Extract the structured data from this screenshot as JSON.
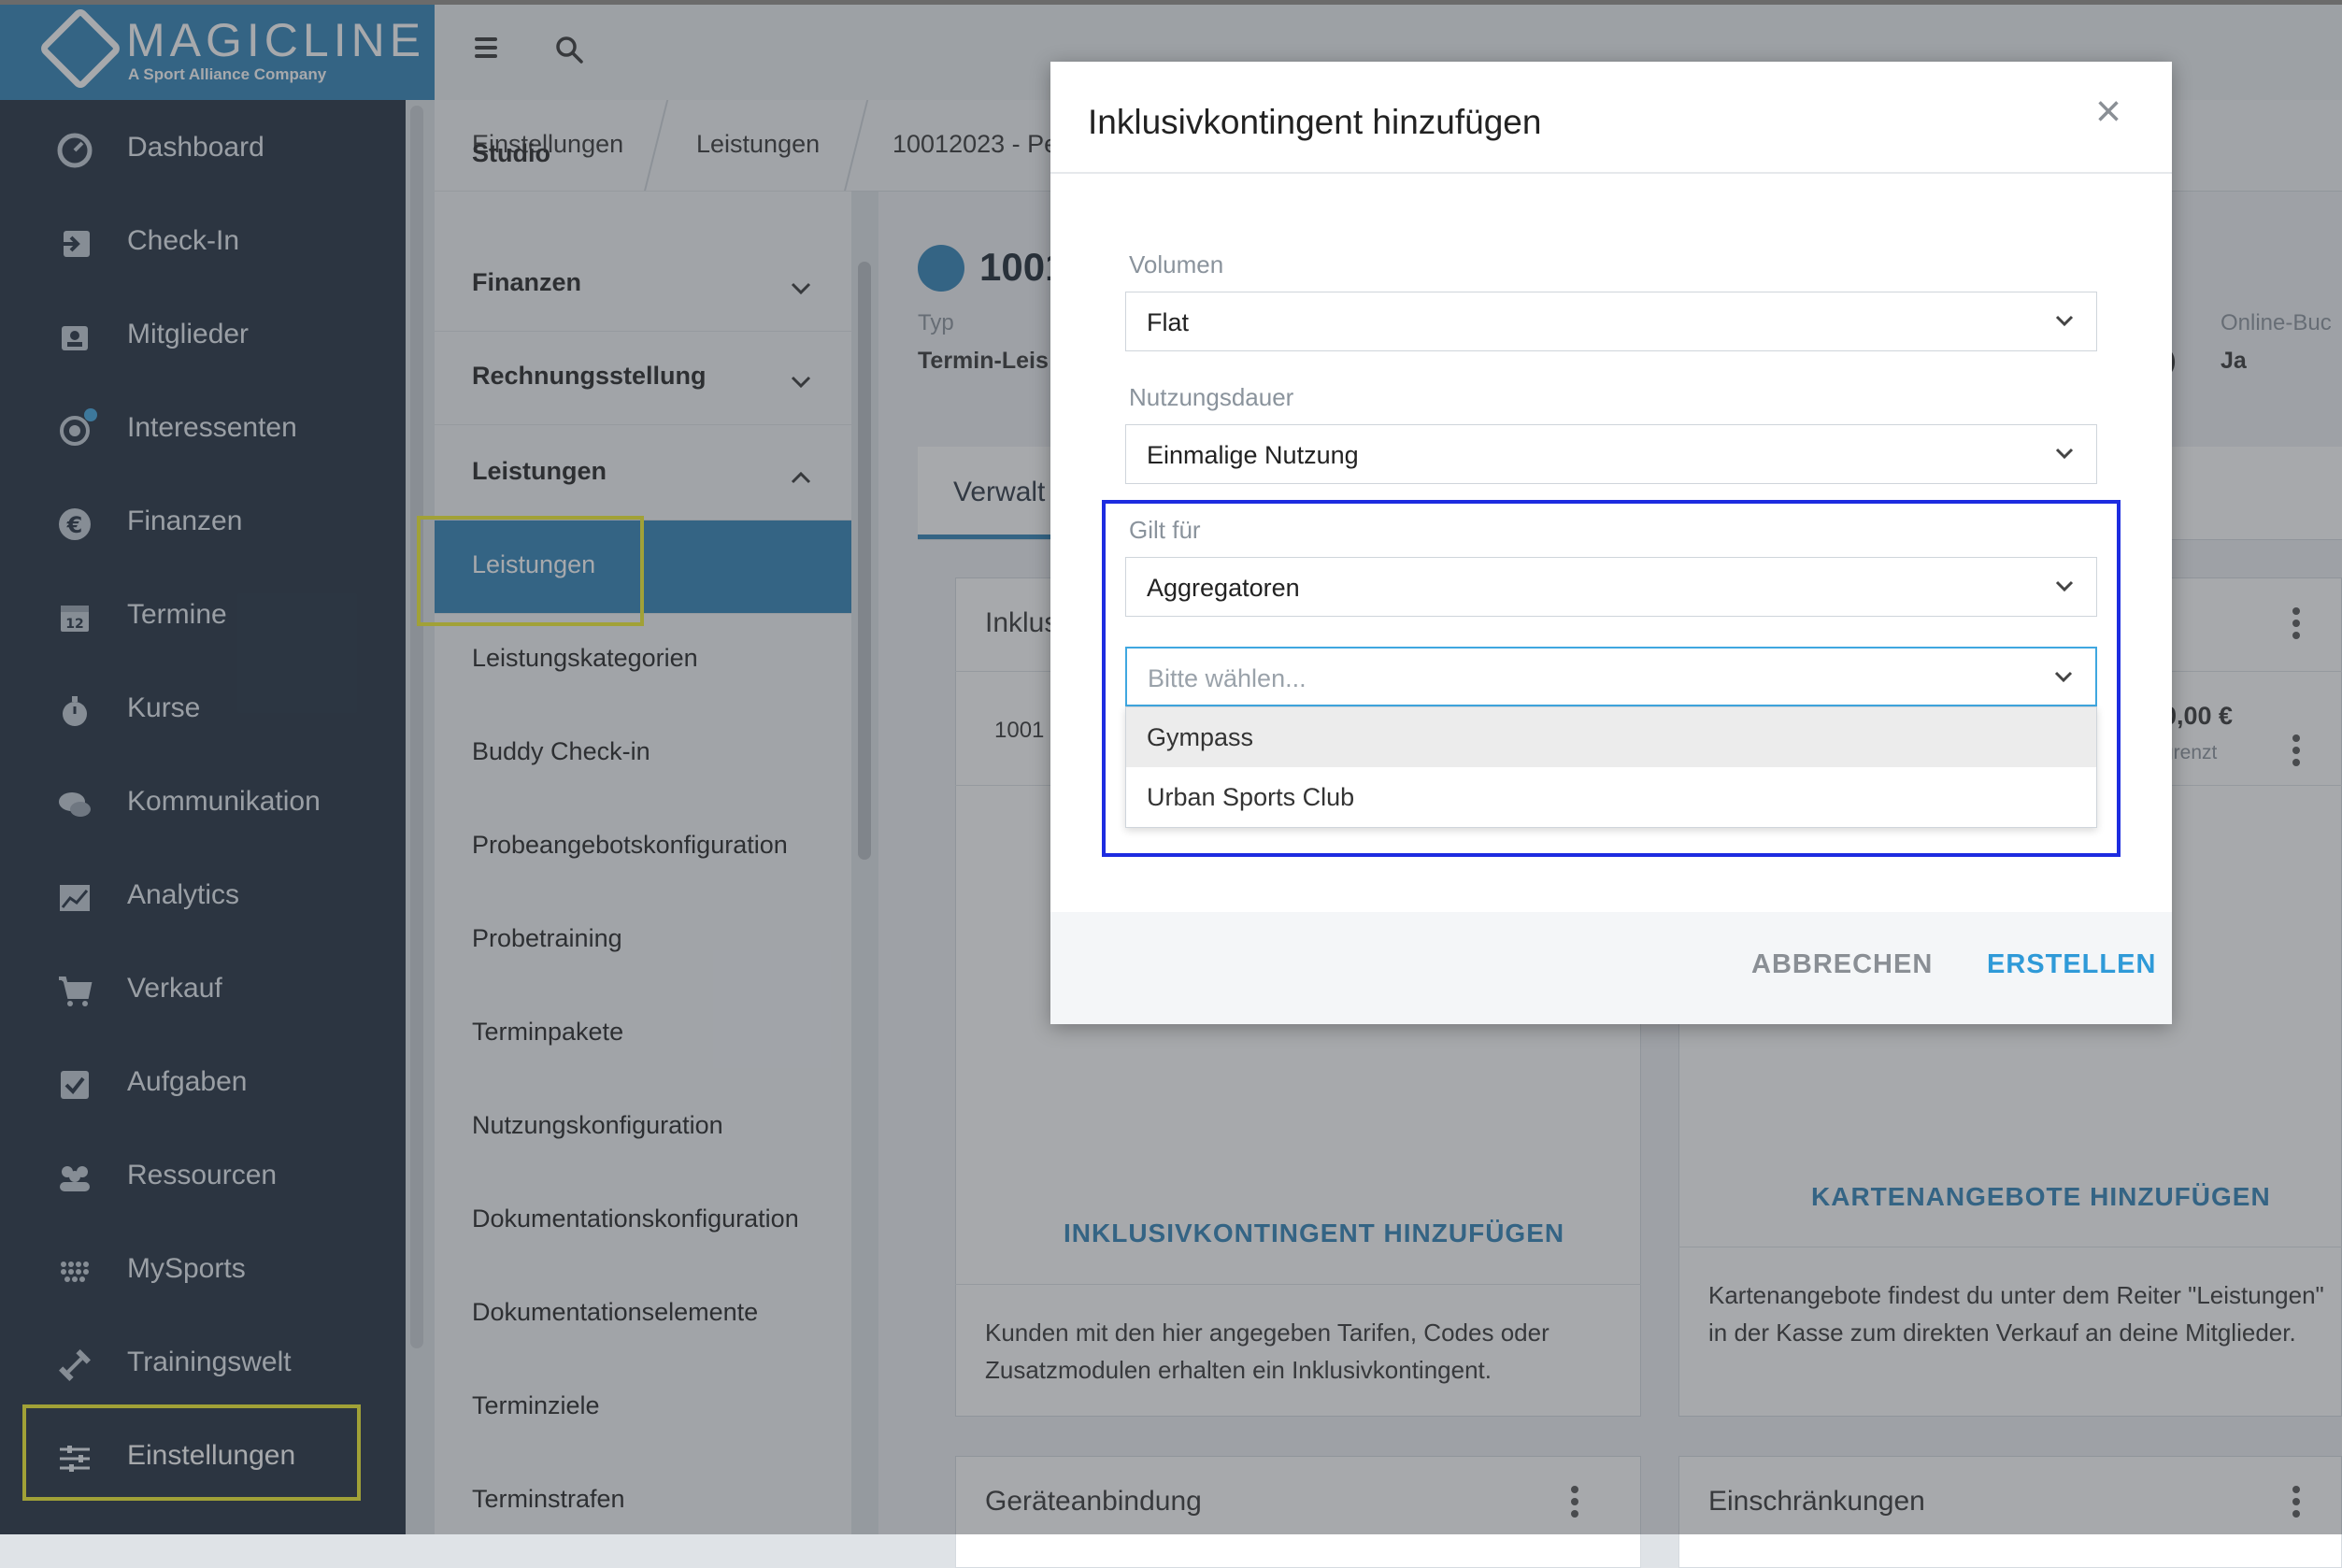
{
  "app": {
    "brand": "MAGICLINE",
    "brand_sub": "A Sport Alliance Company"
  },
  "colors": {
    "brand_blue": "#2f81b7",
    "nav_bg": "#1f2d3d",
    "highlight_yellow": "#f5f02b",
    "focus_box_blue": "#1d2ce0",
    "link_blue": "#2f9ad8"
  },
  "sidebar": {
    "items": [
      {
        "label": "Dashboard",
        "icon": "dashboard-icon"
      },
      {
        "label": "Check-In",
        "icon": "checkin-icon"
      },
      {
        "label": "Mitglieder",
        "icon": "members-icon"
      },
      {
        "label": "Interessenten",
        "icon": "prospects-icon"
      },
      {
        "label": "Finanzen",
        "icon": "euro-icon"
      },
      {
        "label": "Termine",
        "icon": "calendar-icon"
      },
      {
        "label": "Kurse",
        "icon": "stopwatch-icon"
      },
      {
        "label": "Kommunikation",
        "icon": "chat-icon"
      },
      {
        "label": "Analytics",
        "icon": "chart-icon"
      },
      {
        "label": "Verkauf",
        "icon": "cart-icon"
      },
      {
        "label": "Aufgaben",
        "icon": "checkbox-icon"
      },
      {
        "label": "Ressourcen",
        "icon": "people-icon"
      },
      {
        "label": "MySports",
        "icon": "mysports-icon"
      },
      {
        "label": "Trainingswelt",
        "icon": "dumbbell-icon"
      },
      {
        "label": "Einstellungen",
        "icon": "sliders-icon"
      }
    ]
  },
  "breadcrumb": {
    "items": [
      "Einstellungen",
      "Leistungen",
      "10012023 - Per"
    ]
  },
  "settings_nav": {
    "partial_top": "Studio",
    "sections": [
      "Finanzen",
      "Rechnungsstellung",
      "Leistungen"
    ],
    "items": [
      "Leistungen",
      "Leistungskategorien",
      "Buddy Check-in",
      "Probeangebotskonfiguration",
      "Probetraining",
      "Terminpakete",
      "Nutzungskonfiguration",
      "Dokumentationskonfiguration",
      "Dokumentationselemente",
      "Terminziele",
      "Terminstrafen"
    ]
  },
  "content": {
    "title": "1001",
    "typ_label": "Typ",
    "typ_value": "Termin-Leis",
    "online_label": "Online-Buc",
    "online_value": "Ja",
    "paren": ")",
    "tab": "Verwalt",
    "card1_title": "Inklus",
    "card1_row": "1001",
    "card1_link": "INKLUSIVKONTINGENT HINZUFÜGEN",
    "card1_text": "Kunden mit den hier angegeben Tarifen, Codes oder Zusatzmodulen erhalten ein Inklusivkontingent.",
    "card2_amount": "0,00 €",
    "card2_sub": "grenzt",
    "card2_link": "KARTENANGEBOTE HINZUFÜGEN",
    "card2_text": "Kartenangebote findest du unter dem Reiter \"Leistungen\" in der Kasse zum direkten Verkauf an deine Mitglieder.",
    "card3_title": "Geräteanbindung",
    "card4_title": "Einschränkungen"
  },
  "modal": {
    "title": "Inklusivkontingent hinzufügen",
    "close": "×",
    "volumen_label": "Volumen",
    "volumen_value": "Flat",
    "nutzung_label": "Nutzungsdauer",
    "nutzung_value": "Einmalige Nutzung",
    "gilt_label": "Gilt für",
    "gilt_value": "Aggregatoren",
    "choose_placeholder": "Bitte wählen...",
    "options": [
      "Gympass",
      "Urban Sports Club"
    ],
    "cancel": "ABBRECHEN",
    "create": "ERSTELLEN"
  }
}
